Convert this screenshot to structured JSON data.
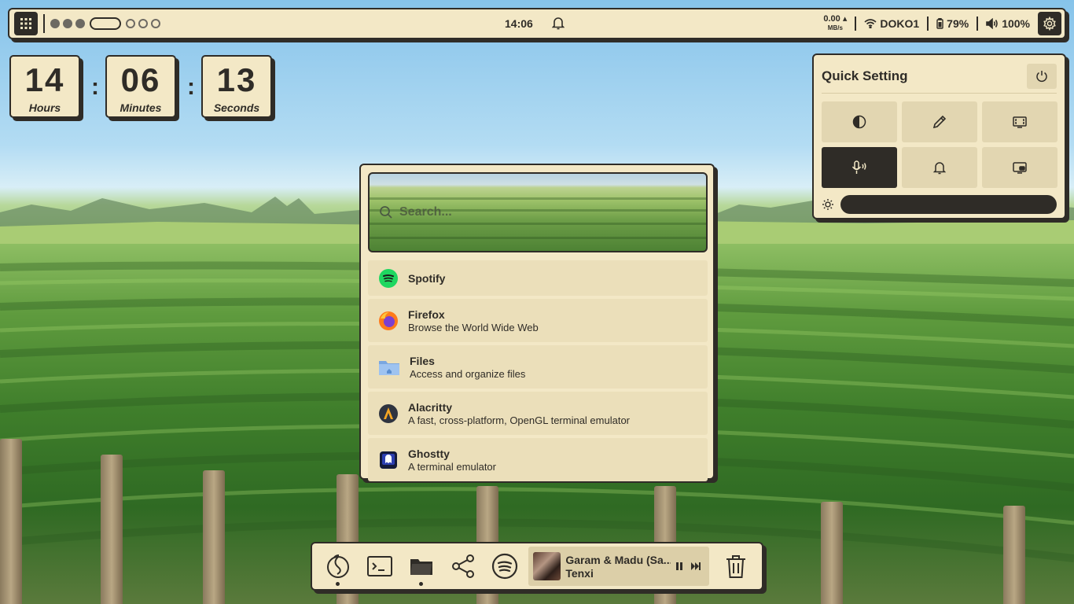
{
  "topbar": {
    "clock": "14:06",
    "net_speed_value": "0.00",
    "net_speed_unit": "MB/s",
    "wifi_name": "DOKO1",
    "battery": "79%",
    "volume": "100%"
  },
  "clock_widget": {
    "hours": "14",
    "hours_label": "Hours",
    "minutes": "06",
    "minutes_label": "Minutes",
    "seconds": "13",
    "seconds_label": "Seconds",
    "separator": ":"
  },
  "launcher": {
    "search_placeholder": "Search...",
    "apps": [
      {
        "name": "Spotify",
        "description": "",
        "icon": "spotify-icon"
      },
      {
        "name": "Firefox",
        "description": "Browse the World Wide Web",
        "icon": "firefox-icon"
      },
      {
        "name": "Files",
        "description": "Access and organize files",
        "icon": "folder-icon"
      },
      {
        "name": "Alacritty",
        "description": "A fast, cross-platform, OpenGL terminal emulator",
        "icon": "alacritty-icon"
      },
      {
        "name": "Ghostty",
        "description": "A terminal emulator",
        "icon": "ghostty-icon"
      }
    ]
  },
  "quick_settings": {
    "title": "Quick Setting",
    "toggles": [
      "contrast-icon",
      "color-picker-icon",
      "screenshot-icon",
      "microphone-icon",
      "bell-icon",
      "screen-record-icon"
    ],
    "active_toggle": "microphone-icon",
    "brightness": 1.0
  },
  "dock": {
    "player": {
      "title": "Garam & Madu (Sa...",
      "artist": "Tenxi"
    }
  },
  "colors": {
    "panel": "#f3e8c6",
    "ink": "#2f2c27",
    "tile": "#ebdfba"
  }
}
